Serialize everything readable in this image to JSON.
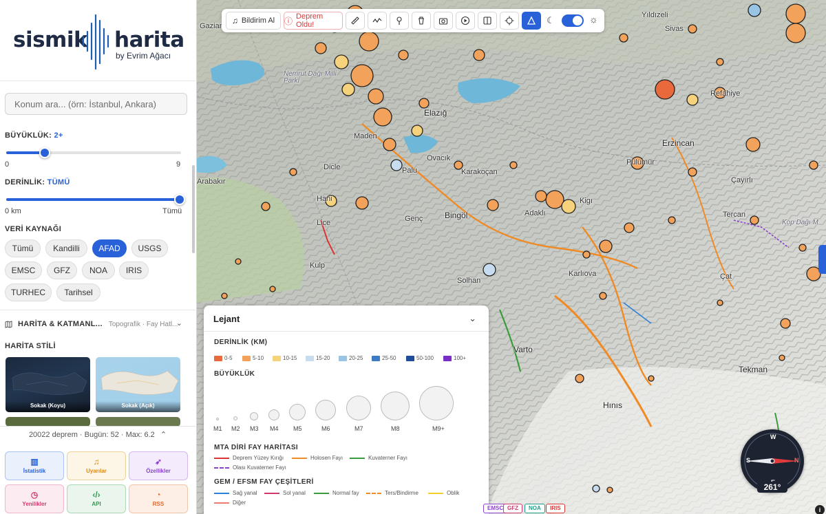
{
  "logo": {
    "word1": "sismik",
    "word2": "harita",
    "byline": "by Evrim Ağacı"
  },
  "search": {
    "placeholder": "Konum ara... (örn: İstanbul, Ankara)"
  },
  "magnitude": {
    "label": "BÜYÜKLÜK:",
    "value": "2+",
    "min_label": "0",
    "max_label": "9",
    "min": 0,
    "max": 9,
    "current": 2
  },
  "depth": {
    "label": "DERİNLİK:",
    "value": "TÜMÜ",
    "min_label": "0 km",
    "max_label": "Tümü",
    "fraction": 1.0
  },
  "sources": {
    "label": "VERİ KAYNAĞI",
    "items": [
      "Tümü",
      "Kandilli",
      "AFAD",
      "USGS",
      "EMSC",
      "GFZ",
      "NOA",
      "IRIS",
      "TURHEC",
      "Tarihsel"
    ],
    "selected": "AFAD"
  },
  "layers": {
    "title": "HARİTA & KATMANL...",
    "subtitle": "Topografik · Fay Hatl..."
  },
  "map_style": {
    "label": "HARİTA STİLİ",
    "items": [
      {
        "name": "Sokak (Koyu)"
      },
      {
        "name": "Sokak (Açık)"
      }
    ]
  },
  "stats": {
    "text": "20022 deprem · Bugün: 52 · Max: 6.2",
    "chevron": "chevron-up-icon"
  },
  "bottom_buttons": [
    {
      "label": "İstatistik",
      "icon": "chart-icon",
      "color": "#2962d8"
    },
    {
      "label": "Uyarılar",
      "icon": "bell-icon",
      "color": "#d98a1a"
    },
    {
      "label": "Özellikler",
      "icon": "rocket-icon",
      "color": "#8a3fd1"
    },
    {
      "label": "Yenilikler",
      "icon": "clock-icon",
      "color": "#d0386e"
    },
    {
      "label": "API",
      "icon": "code-icon",
      "color": "#2e9a4c"
    },
    {
      "label": "RSS",
      "icon": "rss-icon",
      "color": "#e0662a"
    }
  ],
  "toolbar": {
    "notify_label": "Bildirim Al",
    "quake_label": "Deprem Oldu!"
  },
  "places": [
    "Gaziantep",
    "Yıldızeli",
    "Sivas",
    "Nemrut Dağı Milli Parkı",
    "Elazığ",
    "Refahiye",
    "Tercan",
    "Erzincan",
    "Çayırlı",
    "Kop Dağı M",
    "Maden",
    "Dicle",
    "Karakoçan",
    "Palu",
    "Arabakır",
    "Genç",
    "Bingöl",
    "Lice",
    "Hani",
    "Kigı",
    "Adaklı",
    "Solhan",
    "Kulp",
    "Çat",
    "Karlıova",
    "Varto",
    "Tekman",
    "Hınıs",
    "Ovacık",
    "Pülümür"
  ],
  "legend": {
    "title": "Lejant",
    "depth_title": "DERİNLİK (KM)",
    "depth_items": [
      {
        "label": "0-5",
        "color": "#e8693b"
      },
      {
        "label": "5-10",
        "color": "#f2a25a"
      },
      {
        "label": "10-15",
        "color": "#f6d27c"
      },
      {
        "label": "15-20",
        "color": "#c8dcef"
      },
      {
        "label": "20-25",
        "color": "#98c4e6"
      },
      {
        "label": "25-50",
        "color": "#3d7cc4"
      },
      {
        "label": "50-100",
        "color": "#1f4d99"
      },
      {
        "label": "100+",
        "color": "#7a2ec6"
      }
    ],
    "mag_title": "BÜYÜKLÜK",
    "mag_items": [
      "M1",
      "M2",
      "M3",
      "M4",
      "M5",
      "M6",
      "M7",
      "M8",
      "M9+"
    ],
    "mta_title": "MTA DİRİ FAY HARİTASI",
    "mta_items": [
      {
        "label": "Deprem Yüzey Kırığı",
        "color": "#d93636"
      },
      {
        "label": "Holosen Fayı",
        "color": "#f08a24"
      },
      {
        "label": "Kuvaterner Fayı",
        "color": "#3a9b3a"
      },
      {
        "label": "Olası Kuvaterner Fayı",
        "color": "#8a3fd1"
      }
    ],
    "gem_title": "GEM / EFSM FAY ÇEŞİTLERİ",
    "gem_items": [
      {
        "label": "Sağ yanal",
        "color": "#2a7fd9"
      },
      {
        "label": "Sol yanal",
        "color": "#d0386e"
      },
      {
        "label": "Normal fay",
        "color": "#3a9b3a"
      },
      {
        "label": "Ters/Bindirme",
        "color": "#f08a24"
      },
      {
        "label": "Oblik",
        "color": "#f2d02a"
      },
      {
        "label": "Diğer",
        "color": "#ec7b70"
      }
    ]
  },
  "compass": {
    "heading": "261°",
    "n": "N",
    "s": "S",
    "e": "E",
    "w": "W"
  },
  "source_badges": [
    {
      "label": "EMSC",
      "color": "#8a3fd1"
    },
    {
      "label": "GFZ",
      "color": "#d0386e"
    },
    {
      "label": "NOA",
      "color": "#1e9e8a"
    },
    {
      "label": "IRIS",
      "color": "#d93636"
    }
  ],
  "attribution": "i"
}
